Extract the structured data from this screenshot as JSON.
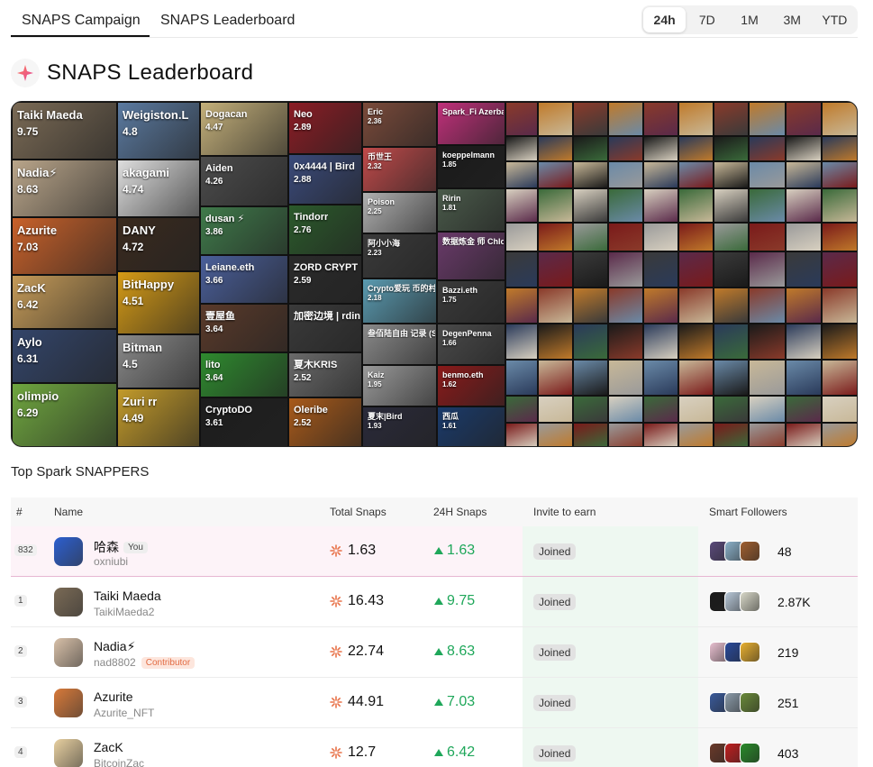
{
  "nav": {
    "tabs": [
      {
        "label": "SNAPS Campaign"
      },
      {
        "label": "SNAPS Leaderboard"
      }
    ],
    "ranges": [
      "24h",
      "7D",
      "1M",
      "3M",
      "YTD"
    ],
    "selected_range": "24h"
  },
  "heading": {
    "title": "SNAPS  Leaderboard",
    "icon": "spark-icon"
  },
  "mosaic": {
    "tiles": [
      {
        "name": "Taiki Maeda",
        "score": "9.75",
        "bg": "#7a6a55"
      },
      {
        "name": "Nadia⚡",
        "score": "8.63",
        "bg": "#b9a58a"
      },
      {
        "name": "Azurite",
        "score": "7.03",
        "bg": "#c8612a"
      },
      {
        "name": "ZacK",
        "score": "6.42",
        "bg": "#c49a58"
      },
      {
        "name": "Aylo",
        "score": "6.31",
        "bg": "#33456a"
      },
      {
        "name": "olimpio",
        "score": "6.29",
        "bg": "#6fa63f"
      },
      {
        "name": "Weigiston.L",
        "score": "4.8",
        "bg": "#5b7aa0"
      },
      {
        "name": "akagami",
        "score": "4.74",
        "bg": "#dedede"
      },
      {
        "name": "DANY",
        "score": "4.72",
        "bg": "#3a2a1e"
      },
      {
        "name": "BitHappy",
        "score": "4.51",
        "bg": "#d49a16"
      },
      {
        "name": "Bitman",
        "score": "4.5",
        "bg": "#8a8a8a"
      },
      {
        "name": "Zuri rr",
        "score": "4.49",
        "bg": "#c29a2a"
      },
      {
        "name": "Dogacan",
        "score": "4.47",
        "bg": "#c4b07a"
      },
      {
        "name": "Aiden",
        "score": "4.26",
        "bg": "#4c4c4c"
      },
      {
        "name": "dusan ⚡",
        "score": "3.86",
        "bg": "#3f7a4a"
      },
      {
        "name": "Leiane.eth",
        "score": "3.66",
        "bg": "#4a5f9a"
      },
      {
        "name": "壹屋鱼",
        "score": "3.64",
        "bg": "#5a3a2a"
      },
      {
        "name": "lito",
        "score": "3.64",
        "bg": "#2e8a2e"
      },
      {
        "name": "CryptoDO",
        "score": "3.61",
        "bg": "#1d1d1d"
      },
      {
        "name": "Neo",
        "score": "2.89",
        "bg": "#8b1c24"
      },
      {
        "name": "0x4444 | Bird",
        "score": "2.88",
        "bg": "#3a4a7a"
      },
      {
        "name": "Tindorr",
        "score": "2.76",
        "bg": "#2b5a2b"
      },
      {
        "name": "ZORD CRYPT",
        "score": "2.59",
        "bg": "#2a2a2a"
      },
      {
        "name": "加密边境 | rdinals",
        "score": "",
        "bg": "#3a3a3a"
      },
      {
        "name": "夏木KRIS",
        "score": "2.52",
        "bg": "#6a6a6a"
      },
      {
        "name": "Oleribe",
        "score": "2.52",
        "bg": "#a85a1a"
      },
      {
        "name": "Eric",
        "score": "2.36",
        "bg": "#7a4a3a"
      },
      {
        "name": "币世王",
        "score": "2.32",
        "bg": "#c04a4a"
      },
      {
        "name": "Poison",
        "score": "2.25",
        "bg": "#b0b0b0"
      },
      {
        "name": "阿小小海",
        "score": "2.23",
        "bg": "#3a3a3a"
      },
      {
        "name": "Crypto爱玩 币的村长",
        "score": "2.18",
        "bg": "#5a9ab0"
      },
      {
        "name": "叁佰陆自由 记录 (SanBai)",
        "score": "",
        "bg": "#8a8a8a"
      },
      {
        "name": "Kaiz",
        "score": "1.95",
        "bg": "#9a9a9a"
      },
      {
        "name": "夏末|Bird",
        "score": "1.93",
        "bg": "#2a2a3a"
      },
      {
        "name": "Spark_Fi Azerbaycan",
        "score": "",
        "bg": "#c0307a"
      },
      {
        "name": "koeppelmann",
        "score": "1.85",
        "bg": "#1a1a1a"
      },
      {
        "name": "Ririn",
        "score": "1.81",
        "bg": "#4a5a4a"
      },
      {
        "name": "数据炼金 师 Chloe Zheng",
        "score": "",
        "bg": "#6a3a6a"
      },
      {
        "name": "Bazzi.eth",
        "score": "1.75",
        "bg": "#3a3a3a"
      },
      {
        "name": "DegenPenna",
        "score": "1.66",
        "bg": "#4a4a4a"
      },
      {
        "name": "benmo.eth",
        "score": "1.62",
        "bg": "#8a1a1a"
      },
      {
        "name": "西瓜",
        "score": "1.61",
        "bg": "#1a3a6a"
      }
    ]
  },
  "section_title": "Top Spark SNAPPERS",
  "table": {
    "headers": [
      "#",
      "Name",
      "Total Snaps",
      "24H Snaps",
      "Invite to earn",
      "Smart Followers"
    ],
    "rows": [
      {
        "rank": "832",
        "name": "哈森",
        "you_badge": "You",
        "handle": "oxniubi",
        "total": "1.63",
        "h24": "1.63",
        "invite": "Joined",
        "followers": "48",
        "avatar": "#2c5fd0",
        "avs": [
          "#5a4a7a",
          "#8ab0c8",
          "#a06030"
        ],
        "me": true
      },
      {
        "rank": "1",
        "name": "Taiki Maeda",
        "handle": "TaikiMaeda2",
        "total": "16.43",
        "h24": "9.75",
        "invite": "Joined",
        "followers": "2.87K",
        "avatar": "#7a6a55",
        "avs": [
          "#1a1a1a",
          "#b8c8d8",
          "#d8d8c8"
        ]
      },
      {
        "rank": "2",
        "name": "Nadia⚡",
        "handle": "nad8802",
        "contrib": "Contributor",
        "total": "22.74",
        "h24": "8.63",
        "invite": "Joined",
        "followers": "219",
        "avatar": "#d8c0a8",
        "avs": [
          "#e8c0d0",
          "#2a4a9a",
          "#e8b030"
        ]
      },
      {
        "rank": "3",
        "name": "Azurite",
        "handle": "Azurite_NFT",
        "total": "44.91",
        "h24": "7.03",
        "invite": "Joined",
        "followers": "251",
        "avatar": "#d87a3a",
        "avs": [
          "#3a5a9a",
          "#8a9aa8",
          "#6a8a3a"
        ]
      },
      {
        "rank": "4",
        "name": "ZacK",
        "handle": "BitcoinZac",
        "total": "12.7",
        "h24": "6.42",
        "invite": "Joined",
        "followers": "403",
        "avatar": "#e8d0a0",
        "avs": [
          "#6a3a2a",
          "#c02020",
          "#2a8a2a"
        ]
      }
    ]
  }
}
